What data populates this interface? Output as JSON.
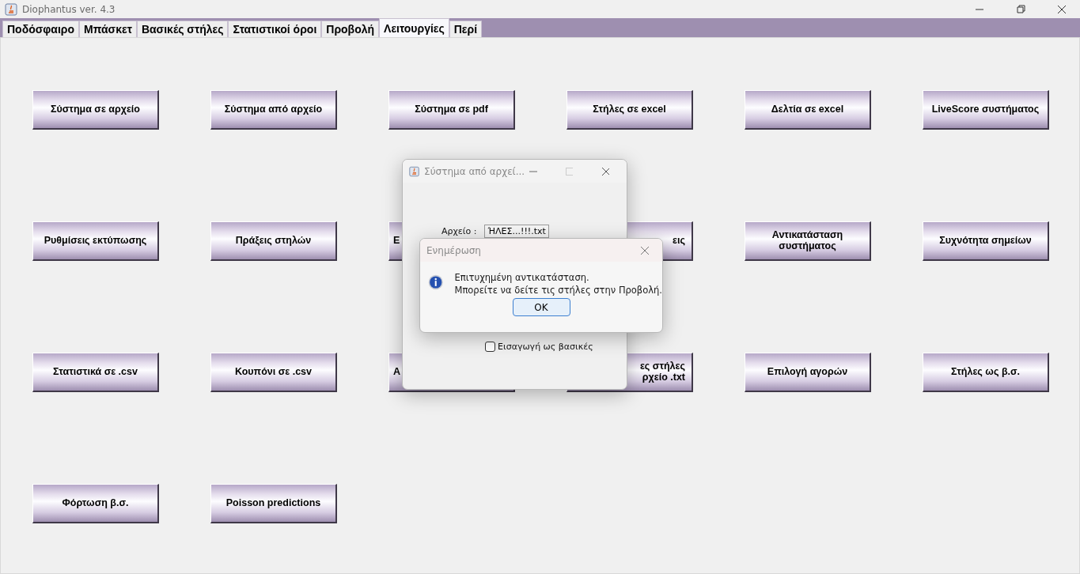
{
  "window": {
    "title": "Diophantus ver. 4.3"
  },
  "tabs": [
    {
      "label": "Ποδόσφαιρο",
      "selected": false
    },
    {
      "label": "Μπάσκετ",
      "selected": false
    },
    {
      "label": "Βασικές στήλες",
      "selected": false
    },
    {
      "label": "Στατιστικοί όροι",
      "selected": false
    },
    {
      "label": "Προβολή",
      "selected": false
    },
    {
      "label": "Λειτουργίες",
      "selected": true
    },
    {
      "label": "Περί",
      "selected": false
    }
  ],
  "buttons": [
    {
      "label": "Σύστημα σε αρχείο",
      "kind": "full"
    },
    {
      "label": "Σύστημα από αρχείο",
      "kind": "full"
    },
    {
      "label": "Σύστημα σε pdf",
      "kind": "full"
    },
    {
      "label": "Στήλες σε excel",
      "kind": "full"
    },
    {
      "label": "Δελτία σε excel",
      "kind": "full"
    },
    {
      "label": "LiveScore συστήματος",
      "kind": "full"
    },
    {
      "label": "Ρυθμίσεις εκτύπωσης",
      "kind": "full"
    },
    {
      "label": "Πράξεις στηλών",
      "kind": "full"
    },
    {
      "label": "Ε",
      "kind": "coveredright"
    },
    {
      "label": "εις",
      "kind": "coveredleft"
    },
    {
      "label": "Αντικατάσταση συστήματος",
      "kind": "full"
    },
    {
      "label": "Συχνότητα σημείων",
      "kind": "full"
    },
    {
      "label": "Στατιστικά σε .csv",
      "kind": "full"
    },
    {
      "label": "Κουπόνι σε .csv",
      "kind": "full"
    },
    {
      "label": "Α",
      "kind": "coveredright"
    },
    {
      "label": "ες στήλες ρχείο .txt",
      "kind": "coveredleft"
    },
    {
      "label": "Επιλογή αγορών",
      "kind": "full"
    },
    {
      "label": "Στήλες ως β.σ.",
      "kind": "full"
    },
    {
      "label": "Φόρτωση β.σ.",
      "kind": "full"
    },
    {
      "label": "Poisson predictions",
      "kind": "full"
    }
  ],
  "file_dialog": {
    "title": "Σύστημα από αρχεί...",
    "file_label": "Αρχείο :",
    "file_value": "ΉΛΕΣ...!!!.txt",
    "checkbox": {
      "label": "Εισαγωγή ως βασικές",
      "checked": false
    }
  },
  "message_dialog": {
    "title": "Ενημέρωση",
    "lines": [
      "Επιτυχημένη αντικατάσταση.",
      "Μπορείτε να δείτε τις στήλες στην Προβολή."
    ],
    "button": "OK"
  }
}
